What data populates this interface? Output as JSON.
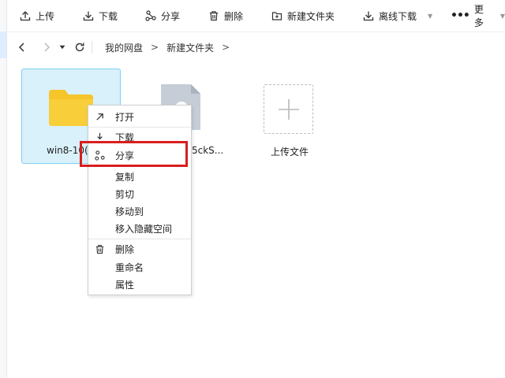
{
  "toolbar": {
    "upload": "上传",
    "download": "下载",
    "share": "分享",
    "delete": "删除",
    "new_folder": "新建文件夹",
    "offline_download": "离线下载",
    "more": "更多"
  },
  "breadcrumb": {
    "root": "我的网盘",
    "sep1": ">",
    "current": "新建文件夹",
    "sep2": ">"
  },
  "files": [
    {
      "name": "win8-10(",
      "icon": "folder-icon"
    },
    {
      "name": "5ckS...",
      "icon": "file-icon"
    }
  ],
  "upload_tile": {
    "label": "上传文件"
  },
  "context_menu": {
    "items": [
      "打开",
      "下载",
      "分享",
      "复制",
      "剪切",
      "移动到",
      "移入隐藏空间",
      "删除",
      "重命名",
      "属性"
    ]
  },
  "colors": {
    "folder": "#f5c52b",
    "selection_bg": "#d9f1fb",
    "selection_border": "#7fd0f0",
    "highlight": "#d81e1e"
  }
}
